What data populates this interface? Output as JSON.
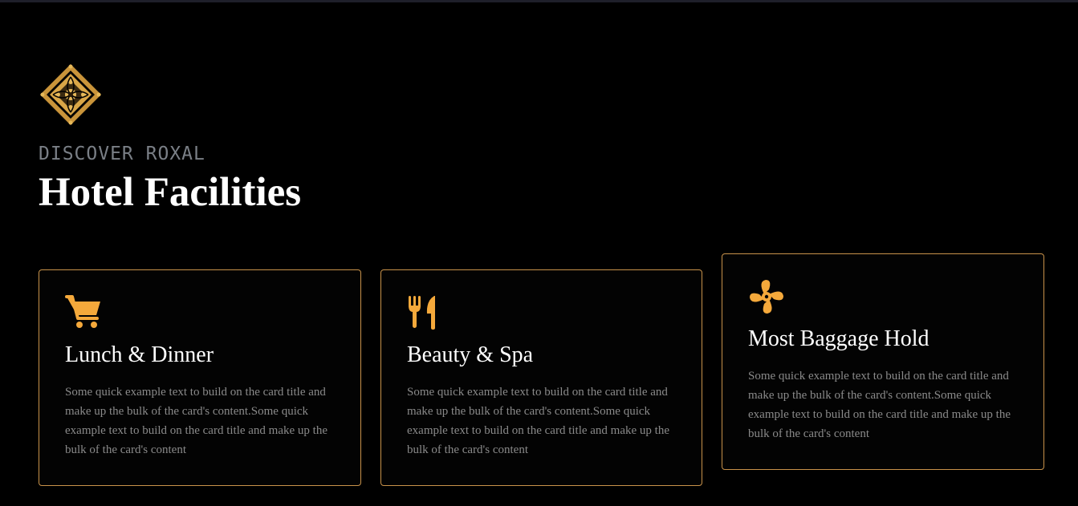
{
  "section": {
    "eyebrow": "DISCOVER ROXAL",
    "title": "Hotel Facilities",
    "emblem_icon": "ornament-emblem-icon"
  },
  "colors": {
    "background": "#000000",
    "accent": "#f5a93b",
    "card_border": "#c8924a",
    "title": "#ffffff",
    "eyebrow": "#7a7f86",
    "body_text": "#8a8a8a"
  },
  "cards": [
    {
      "icon": "shopping-cart-icon",
      "title": "Lunch & Dinner",
      "text": "Some quick example text to build on the card title and make up the bulk of the card's content.Some quick example text to build on the card title and make up the bulk of the card's content"
    },
    {
      "icon": "fork-knife-icon",
      "title": "Beauty & Spa",
      "text": "Some quick example text to build on the card title and make up the bulk of the card's content.Some quick example text to build on the card title and make up the bulk of the card's content"
    },
    {
      "icon": "pinwheel-fan-icon",
      "title": "Most Baggage Hold",
      "text": "Some quick example text to build on the card title and make up the bulk of the card's content.Some quick example text to build on the card title and make up the bulk of the card's content"
    }
  ]
}
